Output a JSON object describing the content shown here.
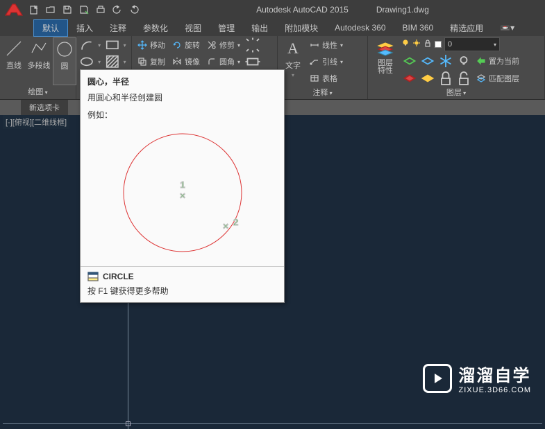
{
  "title": {
    "app": "Autodesk AutoCAD 2015",
    "doc": "Drawing1.dwg"
  },
  "menus": [
    "默认",
    "插入",
    "注释",
    "参数化",
    "视图",
    "管理",
    "输出",
    "附加模块",
    "Autodesk 360",
    "BIM 360",
    "精选应用"
  ],
  "ribbon": {
    "draw": {
      "title": "绘图",
      "line": "直线",
      "polyline": "多段线",
      "circle": "圆"
    },
    "modify": {
      "move": "移动",
      "rotate": "旋转",
      "trim": "修剪",
      "copy": "复制",
      "mirror": "镜像",
      "fillet": "圆角"
    },
    "annotate": {
      "title": "注释",
      "text": "文字",
      "linear": "线性",
      "leader": "引线",
      "table": "表格"
    },
    "layers": {
      "title": "图层",
      "props": "图层\n特性",
      "current_combo": "0",
      "make_current": "置为当前",
      "match": "匹配图层"
    }
  },
  "file_tab": "新选项卡",
  "view_label": "[-][俯视][二维线框]",
  "tooltip": {
    "title": "圆心，半径",
    "desc": "用圆心和半径创建圆",
    "example": "例如：",
    "pt1": "1",
    "pt2": "2",
    "cmd": "CIRCLE",
    "help": "按 F1 键获得更多帮助"
  },
  "watermark": {
    "main": "溜溜自学",
    "sub": "ZIXUE.3D66.COM"
  }
}
